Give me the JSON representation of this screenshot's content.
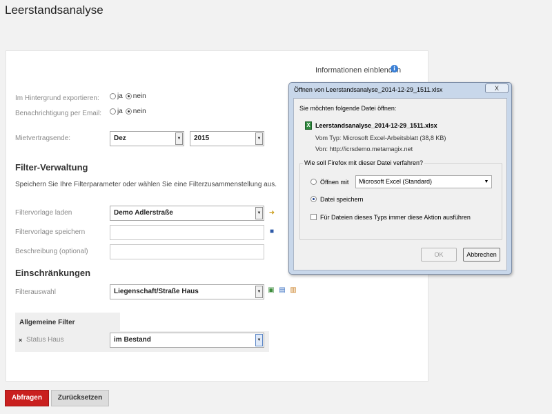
{
  "page": {
    "title": "Leerstandsanalyse"
  },
  "info": {
    "label": "Informationen einblenden",
    "icon": "info-icon"
  },
  "export": {
    "background_label": "Im Hintergrund exportieren:",
    "email_label": "Benachrichtigung per Email:",
    "yes": "ja",
    "no": "nein"
  },
  "contract_end": {
    "label": "Mietvertragsende:",
    "month": "Dez",
    "year": "2015"
  },
  "filter_mgmt": {
    "heading": "Filter-Verwaltung",
    "description": "Speichern Sie Ihre Filterparameter oder wählen Sie eine Filterzusammenstellung aus.",
    "load_label": "Filtervorlage laden",
    "load_value": "Demo Adlerstraße",
    "save_label": "Filtervorlage speichern",
    "description_label": "Beschreibung (optional)"
  },
  "restrictions": {
    "heading": "Einschränkungen",
    "filter_select_label": "Filterauswahl",
    "filter_select_value": "Liegenschaft/Straße Haus",
    "general_filter_heading": "Allgemeine Filter",
    "remove_symbol": "×",
    "status_label": "Status Haus",
    "status_value": "im Bestand"
  },
  "buttons": {
    "query": "Abfragen",
    "reset": "Zurücksetzen"
  },
  "dialog": {
    "title": "Öffnen von Leerstandsanalyse_2014-12-29_1511.xlsx",
    "close": "X",
    "intro": "Sie möchten folgende Datei öffnen:",
    "file_icon_text": "X",
    "filename": "Leerstandsanalyse_2014-12-29_1511.xlsx",
    "type_line": "Vom Typ:  Microsoft Excel-Arbeitsblatt (38,8 KB)",
    "from_line": "Von:  http://icrsdemo.metamagix.net",
    "question": "Wie soll Firefox mit dieser Datei verfahren?",
    "open_with_label": "Öffnen mit",
    "open_with_value": "Microsoft Excel (Standard)",
    "save_label": "Datei speichern",
    "always_label": "Für Dateien dieses Typs immer diese Aktion ausführen",
    "ok": "OK",
    "cancel": "Abbrechen"
  },
  "colors": {
    "primary": "#c9201f",
    "dialog_frame": "#c8d7ea"
  }
}
